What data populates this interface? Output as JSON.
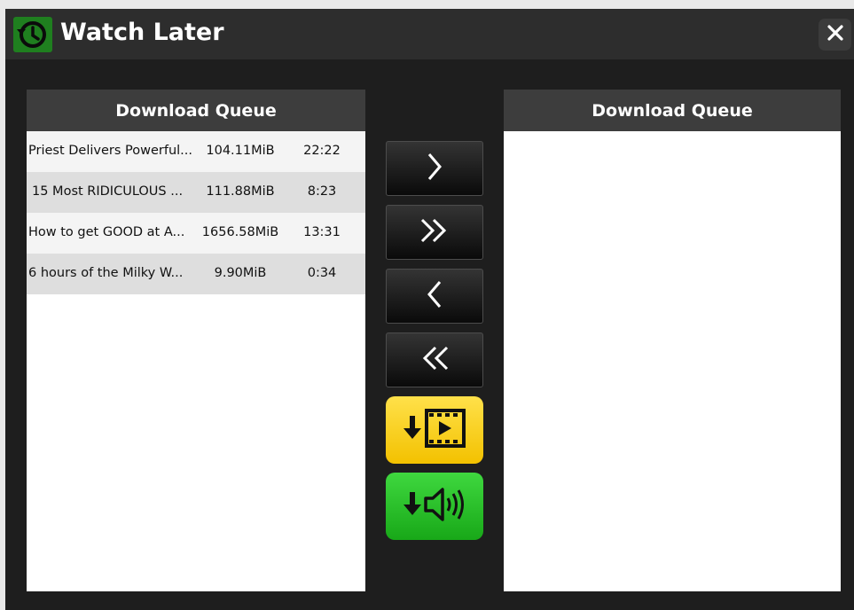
{
  "window": {
    "title": "Watch Later"
  },
  "left_panel": {
    "header": "Download Queue",
    "rows": [
      {
        "title": "Priest Delivers Powerful...",
        "size": "104.11MiB",
        "duration": "22:22"
      },
      {
        "title": "15 Most RIDICULOUS ...",
        "size": "111.88MiB",
        "duration": "8:23"
      },
      {
        "title": "How to get GOOD at A...",
        "size": "1656.58MiB",
        "duration": "13:31"
      },
      {
        "title": "6 hours of the Milky W...",
        "size": "9.90MiB",
        "duration": "0:34"
      }
    ]
  },
  "right_panel": {
    "header": "Download Queue",
    "rows": []
  },
  "controls": {
    "move_right_icon": "chevron-right-icon",
    "move_all_right_icon": "double-chevron-right-icon",
    "move_left_icon": "chevron-left-icon",
    "move_all_left_icon": "double-chevron-left-icon",
    "download_video_icon": "download-video-icon",
    "download_audio_icon": "download-audio-icon"
  },
  "colors": {
    "window_bg": "#1e1e1e",
    "titlebar_bg": "#2d2d2d",
    "app_icon_bg": "#1f7f1f",
    "video_button": "#f3c100",
    "audio_button": "#18a818"
  }
}
